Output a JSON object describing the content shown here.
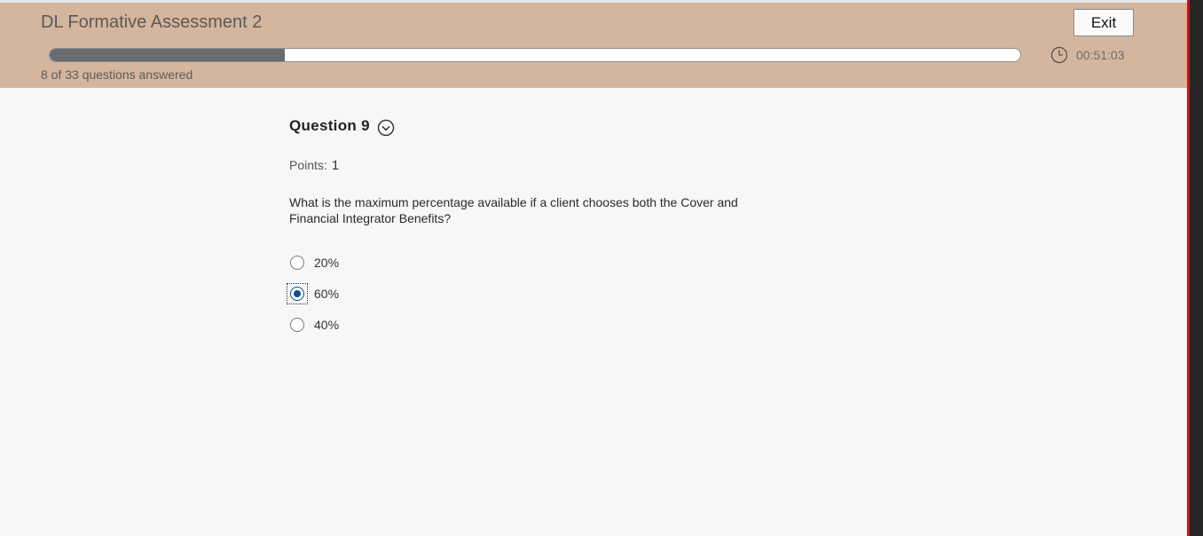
{
  "header": {
    "title": "DL Formative Assessment 2",
    "exit_label": "Exit",
    "progress_fraction": 0.2424,
    "answered_text": "8 of 33 questions answered",
    "timer": "00:51:03",
    "timer_icon": "clock-icon"
  },
  "question": {
    "title": "Question 9",
    "toggle_icon": "chevron-down-circle-icon",
    "points_label": "Points:",
    "points_value": "1",
    "text": "What is the maximum percentage available if a client chooses both the Cover and Financial Integrator Benefits?",
    "options": [
      {
        "label": "20%",
        "selected": false
      },
      {
        "label": "60%",
        "selected": true
      },
      {
        "label": "40%",
        "selected": false
      }
    ]
  },
  "colors": {
    "header_bg": "#d4b59d",
    "progress_fill": "#6a6d70",
    "radio_selected": "#0a4f8f",
    "edge_accent": "#c4161c"
  }
}
